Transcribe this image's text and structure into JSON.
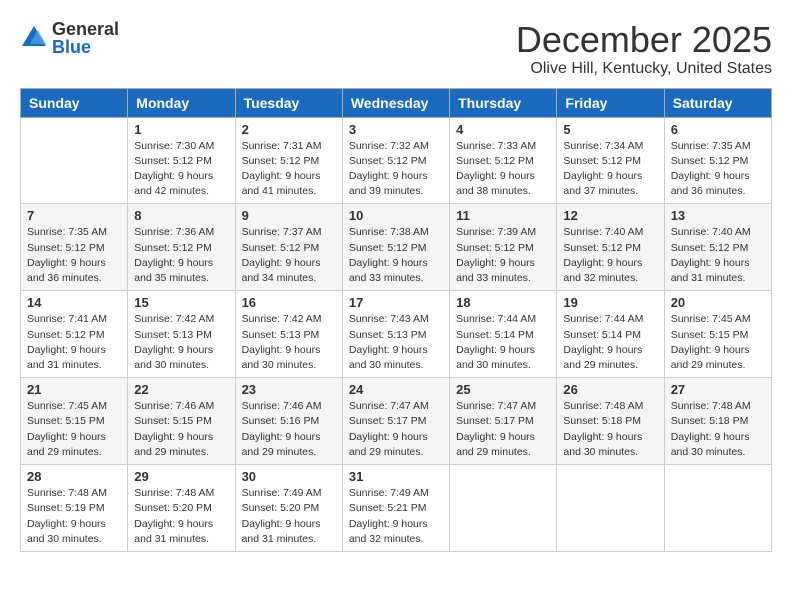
{
  "header": {
    "logo_general": "General",
    "logo_blue": "Blue",
    "month": "December 2025",
    "location": "Olive Hill, Kentucky, United States"
  },
  "days_of_week": [
    "Sunday",
    "Monday",
    "Tuesday",
    "Wednesday",
    "Thursday",
    "Friday",
    "Saturday"
  ],
  "weeks": [
    [
      {
        "day": "",
        "sunrise": "",
        "sunset": "",
        "daylight": ""
      },
      {
        "day": "1",
        "sunrise": "Sunrise: 7:30 AM",
        "sunset": "Sunset: 5:12 PM",
        "daylight": "Daylight: 9 hours and 42 minutes."
      },
      {
        "day": "2",
        "sunrise": "Sunrise: 7:31 AM",
        "sunset": "Sunset: 5:12 PM",
        "daylight": "Daylight: 9 hours and 41 minutes."
      },
      {
        "day": "3",
        "sunrise": "Sunrise: 7:32 AM",
        "sunset": "Sunset: 5:12 PM",
        "daylight": "Daylight: 9 hours and 39 minutes."
      },
      {
        "day": "4",
        "sunrise": "Sunrise: 7:33 AM",
        "sunset": "Sunset: 5:12 PM",
        "daylight": "Daylight: 9 hours and 38 minutes."
      },
      {
        "day": "5",
        "sunrise": "Sunrise: 7:34 AM",
        "sunset": "Sunset: 5:12 PM",
        "daylight": "Daylight: 9 hours and 37 minutes."
      },
      {
        "day": "6",
        "sunrise": "Sunrise: 7:35 AM",
        "sunset": "Sunset: 5:12 PM",
        "daylight": "Daylight: 9 hours and 36 minutes."
      }
    ],
    [
      {
        "day": "7",
        "sunrise": "Sunrise: 7:35 AM",
        "sunset": "Sunset: 5:12 PM",
        "daylight": "Daylight: 9 hours and 36 minutes."
      },
      {
        "day": "8",
        "sunrise": "Sunrise: 7:36 AM",
        "sunset": "Sunset: 5:12 PM",
        "daylight": "Daylight: 9 hours and 35 minutes."
      },
      {
        "day": "9",
        "sunrise": "Sunrise: 7:37 AM",
        "sunset": "Sunset: 5:12 PM",
        "daylight": "Daylight: 9 hours and 34 minutes."
      },
      {
        "day": "10",
        "sunrise": "Sunrise: 7:38 AM",
        "sunset": "Sunset: 5:12 PM",
        "daylight": "Daylight: 9 hours and 33 minutes."
      },
      {
        "day": "11",
        "sunrise": "Sunrise: 7:39 AM",
        "sunset": "Sunset: 5:12 PM",
        "daylight": "Daylight: 9 hours and 33 minutes."
      },
      {
        "day": "12",
        "sunrise": "Sunrise: 7:40 AM",
        "sunset": "Sunset: 5:12 PM",
        "daylight": "Daylight: 9 hours and 32 minutes."
      },
      {
        "day": "13",
        "sunrise": "Sunrise: 7:40 AM",
        "sunset": "Sunset: 5:12 PM",
        "daylight": "Daylight: 9 hours and 31 minutes."
      }
    ],
    [
      {
        "day": "14",
        "sunrise": "Sunrise: 7:41 AM",
        "sunset": "Sunset: 5:12 PM",
        "daylight": "Daylight: 9 hours and 31 minutes."
      },
      {
        "day": "15",
        "sunrise": "Sunrise: 7:42 AM",
        "sunset": "Sunset: 5:13 PM",
        "daylight": "Daylight: 9 hours and 30 minutes."
      },
      {
        "day": "16",
        "sunrise": "Sunrise: 7:42 AM",
        "sunset": "Sunset: 5:13 PM",
        "daylight": "Daylight: 9 hours and 30 minutes."
      },
      {
        "day": "17",
        "sunrise": "Sunrise: 7:43 AM",
        "sunset": "Sunset: 5:13 PM",
        "daylight": "Daylight: 9 hours and 30 minutes."
      },
      {
        "day": "18",
        "sunrise": "Sunrise: 7:44 AM",
        "sunset": "Sunset: 5:14 PM",
        "daylight": "Daylight: 9 hours and 30 minutes."
      },
      {
        "day": "19",
        "sunrise": "Sunrise: 7:44 AM",
        "sunset": "Sunset: 5:14 PM",
        "daylight": "Daylight: 9 hours and 29 minutes."
      },
      {
        "day": "20",
        "sunrise": "Sunrise: 7:45 AM",
        "sunset": "Sunset: 5:15 PM",
        "daylight": "Daylight: 9 hours and 29 minutes."
      }
    ],
    [
      {
        "day": "21",
        "sunrise": "Sunrise: 7:45 AM",
        "sunset": "Sunset: 5:15 PM",
        "daylight": "Daylight: 9 hours and 29 minutes."
      },
      {
        "day": "22",
        "sunrise": "Sunrise: 7:46 AM",
        "sunset": "Sunset: 5:15 PM",
        "daylight": "Daylight: 9 hours and 29 minutes."
      },
      {
        "day": "23",
        "sunrise": "Sunrise: 7:46 AM",
        "sunset": "Sunset: 5:16 PM",
        "daylight": "Daylight: 9 hours and 29 minutes."
      },
      {
        "day": "24",
        "sunrise": "Sunrise: 7:47 AM",
        "sunset": "Sunset: 5:17 PM",
        "daylight": "Daylight: 9 hours and 29 minutes."
      },
      {
        "day": "25",
        "sunrise": "Sunrise: 7:47 AM",
        "sunset": "Sunset: 5:17 PM",
        "daylight": "Daylight: 9 hours and 29 minutes."
      },
      {
        "day": "26",
        "sunrise": "Sunrise: 7:48 AM",
        "sunset": "Sunset: 5:18 PM",
        "daylight": "Daylight: 9 hours and 30 minutes."
      },
      {
        "day": "27",
        "sunrise": "Sunrise: 7:48 AM",
        "sunset": "Sunset: 5:18 PM",
        "daylight": "Daylight: 9 hours and 30 minutes."
      }
    ],
    [
      {
        "day": "28",
        "sunrise": "Sunrise: 7:48 AM",
        "sunset": "Sunset: 5:19 PM",
        "daylight": "Daylight: 9 hours and 30 minutes."
      },
      {
        "day": "29",
        "sunrise": "Sunrise: 7:48 AM",
        "sunset": "Sunset: 5:20 PM",
        "daylight": "Daylight: 9 hours and 31 minutes."
      },
      {
        "day": "30",
        "sunrise": "Sunrise: 7:49 AM",
        "sunset": "Sunset: 5:20 PM",
        "daylight": "Daylight: 9 hours and 31 minutes."
      },
      {
        "day": "31",
        "sunrise": "Sunrise: 7:49 AM",
        "sunset": "Sunset: 5:21 PM",
        "daylight": "Daylight: 9 hours and 32 minutes."
      },
      {
        "day": "",
        "sunrise": "",
        "sunset": "",
        "daylight": ""
      },
      {
        "day": "",
        "sunrise": "",
        "sunset": "",
        "daylight": ""
      },
      {
        "day": "",
        "sunrise": "",
        "sunset": "",
        "daylight": ""
      }
    ]
  ]
}
